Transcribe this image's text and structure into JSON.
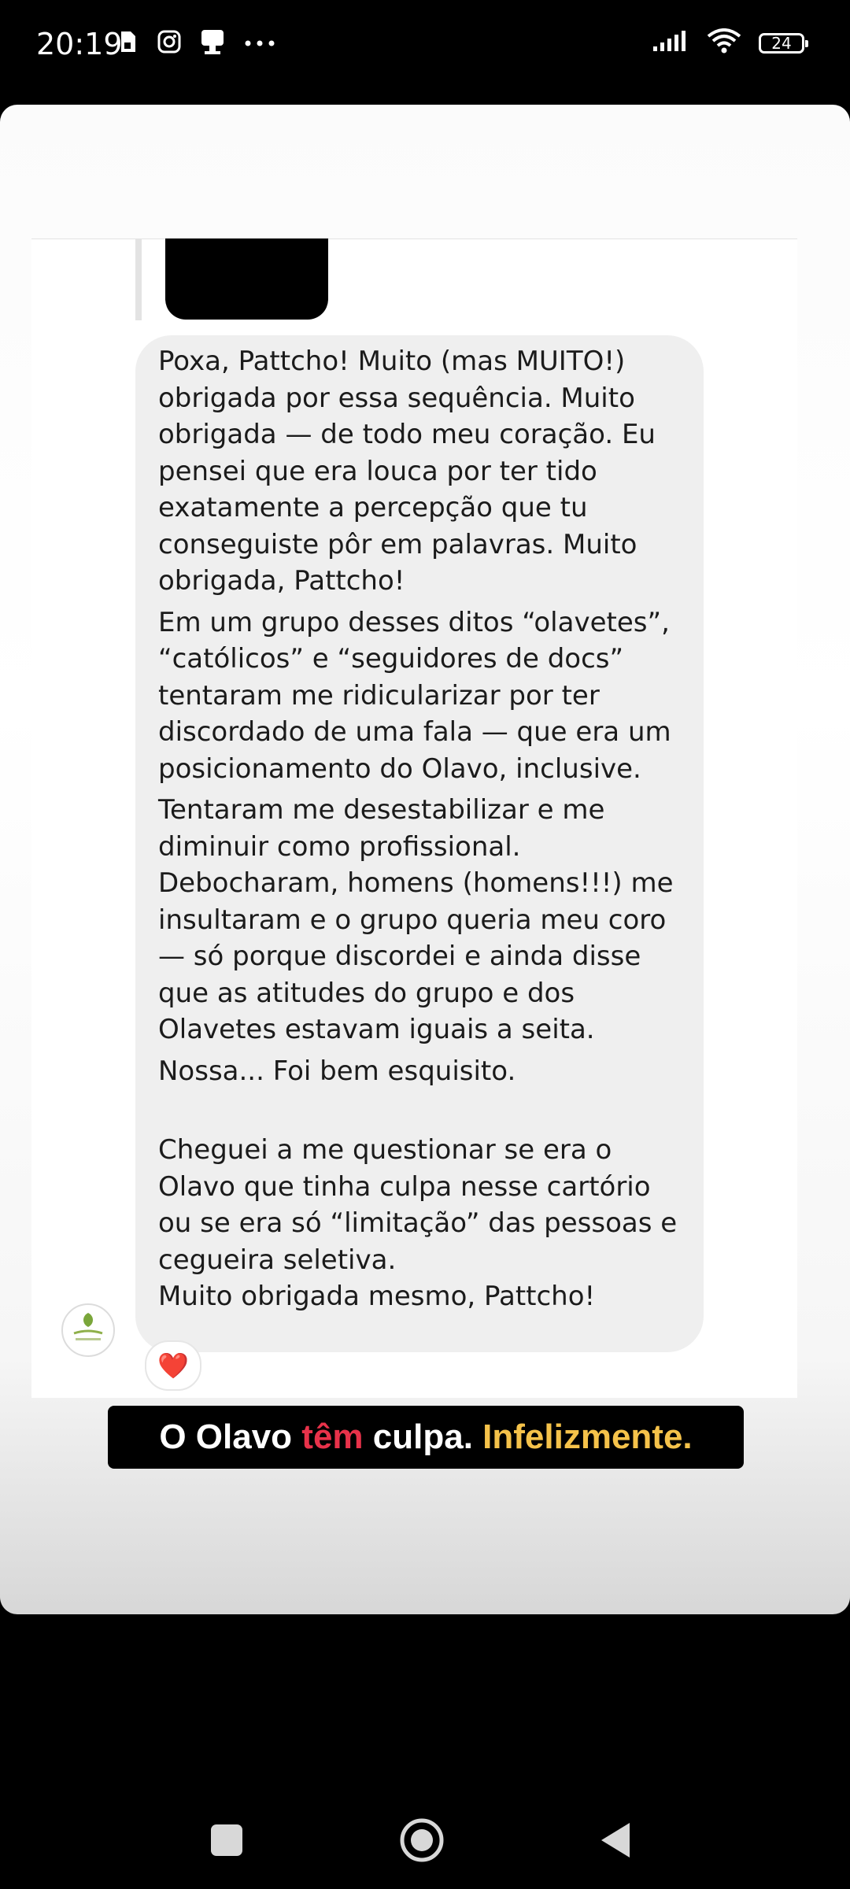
{
  "status_bar": {
    "time": "20:19",
    "battery_level": "24",
    "icons_left": [
      "sim-icon",
      "instagram-icon",
      "notification-icon",
      "more-dots-icon"
    ],
    "icons_right": [
      "signal-icon",
      "wifi-icon",
      "battery-icon"
    ]
  },
  "message": {
    "paragraphs": [
      "Poxa, Pattcho! Muito (mas MUITO!)\nobrigada por essa sequência. Muito\nobrigada — de todo meu coração. Eu\npensei que era louca por ter tido\nexatamente a percepção que tu\nconseguiste pôr em palavras. Muito\nobrigada, Pattcho!",
      "Em um grupo desses ditos “olavetes”,\n“católicos” e “seguidores de docs”\ntentaram me ridicularizar por ter\ndiscordado de uma fala — que era um\nposicionamento do Olavo, inclusive.",
      "Tentaram me desestabilizar e me\ndiminuir como profissional.\nDebocharam, homens (homens!!!) me\ninsultaram e o grupo queria meu coro\n— só porque discordei e ainda disse\nque as atitudes do grupo e dos\nOlavetes estavam iguais a seita.",
      "Nossa... Foi bem esquisito.",
      "Cheguei a me questionar se era o\nOlavo que tinha culpa nesse cartório\nou se era só “limitação” das pessoas e\ncegueira seletiva.\nMuito obrigada mesmo, Pattcho!"
    ],
    "reaction": "❤️"
  },
  "caption": {
    "part1": "O Olavo ",
    "part2": "têm",
    "part3": " culpa. ",
    "part4": "Infelizmente.",
    "colors": {
      "highlight_red": "#e8324a",
      "highlight_yellow": "#f5c24a",
      "text": "#ffffff",
      "background": "#000000"
    }
  },
  "nav_bar": {
    "buttons": [
      "recents-button",
      "home-button",
      "back-button"
    ]
  }
}
